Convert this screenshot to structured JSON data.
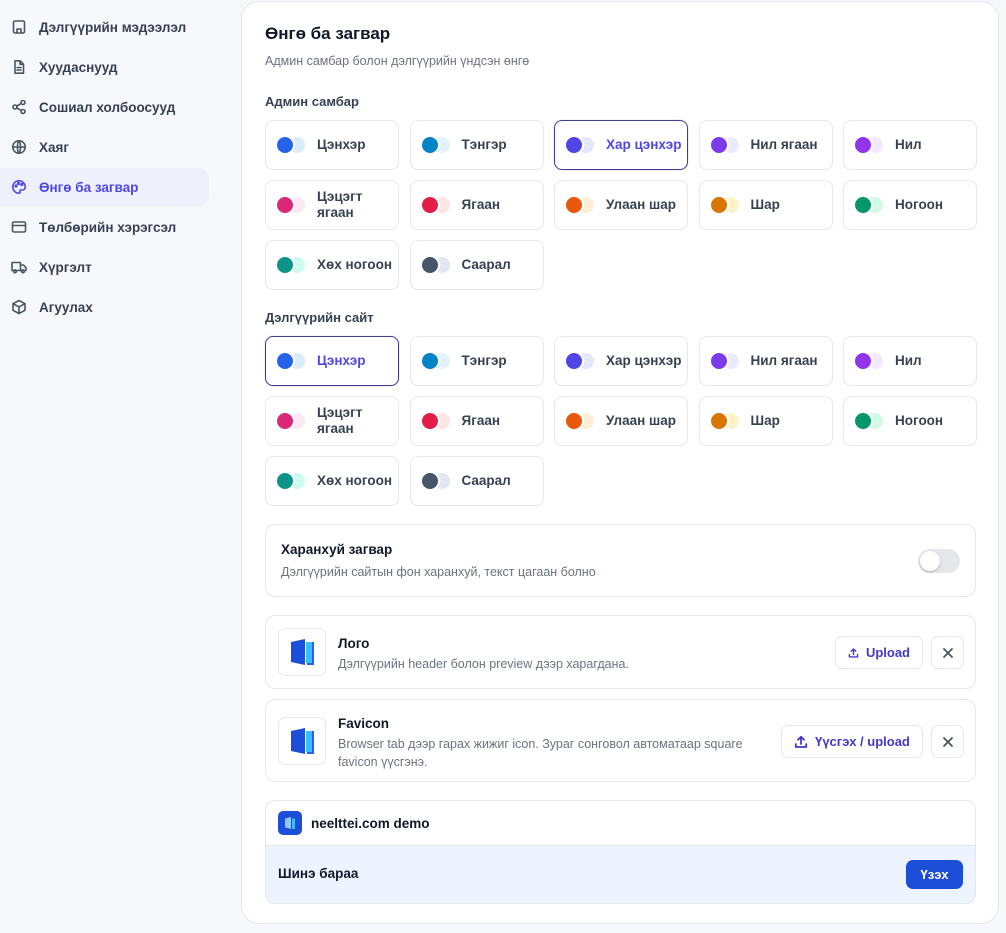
{
  "sidebar": {
    "items": [
      {
        "label": "Дэлгүүрийн мэдээлэл",
        "icon": "store-icon",
        "active": false
      },
      {
        "label": "Хуудаснууд",
        "icon": "file-icon",
        "active": false
      },
      {
        "label": "Сошиал холбоосууд",
        "icon": "share-icon",
        "active": false
      },
      {
        "label": "Хаяг",
        "icon": "globe-icon",
        "active": false
      },
      {
        "label": "Өнгө ба загвар",
        "icon": "palette-icon",
        "active": true
      },
      {
        "label": "Төлбөрийн хэрэгсэл",
        "icon": "credit-card-icon",
        "active": false
      },
      {
        "label": "Хүргэлт",
        "icon": "truck-icon",
        "active": false
      },
      {
        "label": "Агуулах",
        "icon": "box-icon",
        "active": false
      }
    ]
  },
  "page": {
    "title": "Өнгө ба загвар",
    "subtitle": "Админ самбар болон дэлгүүрийн үндсэн өнгө"
  },
  "admin": {
    "label": "Админ самбар",
    "selected": "Хар цэнхэр"
  },
  "store": {
    "label": "Дэлгүүрийн сайт",
    "selected": "Цэнхэр"
  },
  "colors": [
    {
      "label": "Цэнхэр",
      "c1": "#2563eb",
      "c2": "#dbeafe"
    },
    {
      "label": "Тэнгэр",
      "c1": "#0284c7",
      "c2": "#e0f2fe"
    },
    {
      "label": "Хар цэнхэр",
      "c1": "#4f46e5",
      "c2": "#e0e7ff"
    },
    {
      "label": "Нил ягаан",
      "c1": "#7c3aed",
      "c2": "#ede9fe"
    },
    {
      "label": "Нил",
      "c1": "#9333ea",
      "c2": "#f3e8ff"
    },
    {
      "label": "Цэцэгт ягаан",
      "c1": "#db2777",
      "c2": "#fce7f3"
    },
    {
      "label": "Ягаан",
      "c1": "#e11d48",
      "c2": "#ffe4e6"
    },
    {
      "label": "Улаан шар",
      "c1": "#ea580c",
      "c2": "#ffedd5"
    },
    {
      "label": "Шар",
      "c1": "#d97706",
      "c2": "#fef3c7"
    },
    {
      "label": "Ногоон",
      "c1": "#059669",
      "c2": "#d1fae5"
    },
    {
      "label": "Хөх ногоон",
      "c1": "#0d9488",
      "c2": "#ccfbf1"
    },
    {
      "label": "Саарал",
      "c1": "#475569",
      "c2": "#e2e8f0"
    }
  ],
  "dark_mode": {
    "title": "Харанхуй загвар",
    "description": "Дэлгүүрийн сайтын фон харанхуй, текст цагаан болно",
    "enabled": false
  },
  "logo": {
    "title": "Лого",
    "description": "Дэлгүүрийн header болон preview дээр харагдана.",
    "upload_label": "Upload"
  },
  "favicon": {
    "title": "Favicon",
    "description_line1": "Browser tab дээр гарах жижиг icon. Зураг сонговол автоматаар square",
    "description_line2": "favicon үүсгэнэ.",
    "upload_label": "Үүсгэх / upload"
  },
  "preview": {
    "site_name": "neelttei.com demo",
    "product": "Шинэ бараа",
    "button": "Үзэх"
  },
  "theme": {
    "accent": "#4f46e5",
    "preview_button": "#1d4ed8"
  }
}
